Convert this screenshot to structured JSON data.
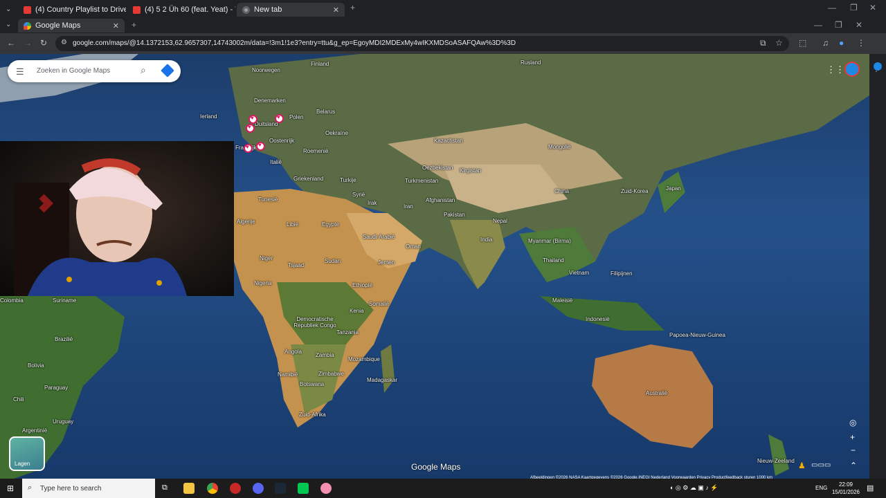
{
  "browser": {
    "tabs_row1": [
      {
        "label": "(4) Country Playlist to Drive to ..."
      },
      {
        "label": "(4) 5 2 Üh 60 (feat. Yeat) - Y..."
      },
      {
        "label": "New tab"
      }
    ],
    "tabs_row2": [
      {
        "label": "Google Maps"
      }
    ],
    "url": "google.com/maps/@14.1372153,62.9657307,14743002m/data=!3m1!1e3?entry=ttu&g_ep=EgoyMDI2MDExMy4wIKXMDSoASAFQAw%3D%3D"
  },
  "maps": {
    "search_placeholder": "Zoeken in Google Maps",
    "layers_label": "Lagen",
    "logo": "Google Maps",
    "attribution": "Afbeeldingen ©2026 NASA Kaartgegevens ©2026 Google,INEGI   Nederland   Voorwaarden   Privacy   Productfeedback sturen   1000 km",
    "labels": [
      {
        "text": "Noorwegen"
      },
      {
        "text": "Finland"
      },
      {
        "text": "Rusland"
      },
      {
        "text": "Denemarken"
      },
      {
        "text": "Belarus"
      },
      {
        "text": "Ierland"
      },
      {
        "text": "Polen"
      },
      {
        "text": "Duitsland"
      },
      {
        "text": "Oekraïne"
      },
      {
        "text": "Oostenrijk"
      },
      {
        "text": "Frankrijk"
      },
      {
        "text": "Roemenië"
      },
      {
        "text": "Kazachstan"
      },
      {
        "text": "Mongolië"
      },
      {
        "text": "Italië"
      },
      {
        "text": "Griekenland"
      },
      {
        "text": "Turkije"
      },
      {
        "text": "Oezbekistan"
      },
      {
        "text": "Kirgistan"
      },
      {
        "text": "Turkmenistan"
      },
      {
        "text": "Zuid-Korea"
      },
      {
        "text": "Japan"
      },
      {
        "text": "China"
      },
      {
        "text": "Syrië"
      },
      {
        "text": "Tunesië"
      },
      {
        "text": "Irak"
      },
      {
        "text": "Afghanistan"
      },
      {
        "text": "Iran"
      },
      {
        "text": "Algerije"
      },
      {
        "text": "Libië"
      },
      {
        "text": "Egypte"
      },
      {
        "text": "Pakistan"
      },
      {
        "text": "Nepal"
      },
      {
        "text": "Saudi-Arabië"
      },
      {
        "text": "India"
      },
      {
        "text": "Oman"
      },
      {
        "text": "Myanmar (Birma)"
      },
      {
        "text": "Niger"
      },
      {
        "text": "Tsjaad"
      },
      {
        "text": "Sudan"
      },
      {
        "text": "Jemen"
      },
      {
        "text": "Thailand"
      },
      {
        "text": "Vietnam"
      },
      {
        "text": "Filipijnen"
      },
      {
        "text": "Nigeria"
      },
      {
        "text": "Ethiopië"
      },
      {
        "text": "Colombia"
      },
      {
        "text": "Suriname"
      },
      {
        "text": "Somalië"
      },
      {
        "text": "Maleisië"
      },
      {
        "text": "Kenia"
      },
      {
        "text": "Democratische Republiek Congo"
      },
      {
        "text": "Indonesië"
      },
      {
        "text": "Brazilië"
      },
      {
        "text": "Tanzania"
      },
      {
        "text": "Papoea-Nieuw-Guinea"
      },
      {
        "text": "Angola"
      },
      {
        "text": "Zambia"
      },
      {
        "text": "Bolivia"
      },
      {
        "text": "Mozambique"
      },
      {
        "text": "Namibië"
      },
      {
        "text": "Zimbabwe"
      },
      {
        "text": "Paraguay"
      },
      {
        "text": "Botswana"
      },
      {
        "text": "Madagaskar"
      },
      {
        "text": "Australië"
      },
      {
        "text": "Chili"
      },
      {
        "text": "Zuid-Afrika"
      },
      {
        "text": "Uruguay"
      },
      {
        "text": "Argentinië"
      },
      {
        "text": "Nieuw-Zeeland"
      }
    ]
  },
  "taskbar": {
    "search_placeholder": "Type here to search",
    "language": "ENG",
    "time": "22:09",
    "date": "15/01/2026"
  },
  "colors": {
    "pin": "#d81b60",
    "ocean": "#1d4478",
    "browser_bg": "#202124"
  }
}
